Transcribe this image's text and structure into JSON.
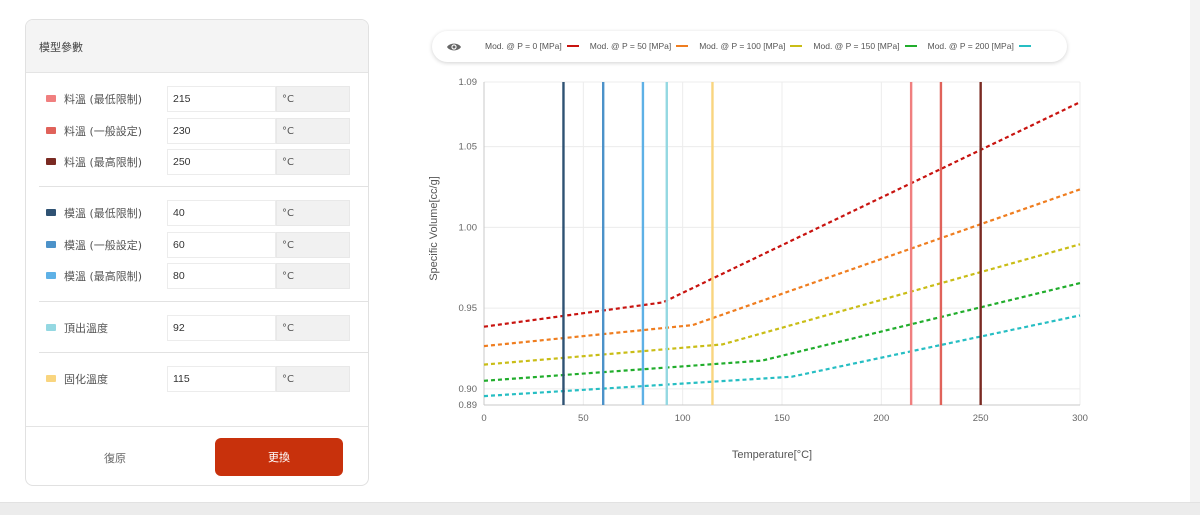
{
  "panel": {
    "title": "模型參數",
    "rows": [
      {
        "label": "料溫 (最低限制)",
        "value": "215",
        "unit": "°C",
        "color": "#f07f7f"
      },
      {
        "label": "料溫 (一般設定)",
        "value": "230",
        "unit": "°C",
        "color": "#e0625a"
      },
      {
        "label": "料溫 (最高限制)",
        "value": "250",
        "unit": "°C",
        "color": "#7a2a22"
      },
      {
        "label": "模溫 (最低限制)",
        "value": "40",
        "unit": "°C",
        "color": "#2f5273"
      },
      {
        "label": "模溫 (一般設定)",
        "value": "60",
        "unit": "°C",
        "color": "#4c92c9"
      },
      {
        "label": "模溫 (最高限制)",
        "value": "80",
        "unit": "°C",
        "color": "#5eb1e6"
      },
      {
        "label": "頂出溫度",
        "value": "92",
        "unit": "°C",
        "color": "#94d8e2"
      },
      {
        "label": "固化溫度",
        "value": "115",
        "unit": "°C",
        "color": "#f9d57f"
      }
    ],
    "reset_label": "復原",
    "apply_label": "更換"
  },
  "chart_data": {
    "type": "line",
    "xlabel": "Temperature[°C]",
    "ylabel": "Specific Volume[cc/g]",
    "xlim": [
      0,
      300
    ],
    "ylim": [
      0.89,
      1.09
    ],
    "x_ticks": [
      0,
      50,
      100,
      150,
      200,
      250,
      300
    ],
    "y_ticks": [
      0.89,
      0.9,
      0.95,
      1.0,
      1.05,
      1.09
    ],
    "y_tick_labels": [
      "0.89",
      "0.90",
      "0.95",
      "1.00",
      "1.05",
      "1.09"
    ],
    "grid": true,
    "legend_position": "top",
    "series": [
      {
        "name": "Mod. @ P = 0 [MPa]",
        "color": "#c8130f",
        "points": [
          [
            0,
            0.9385
          ],
          [
            90,
            0.9535
          ],
          [
            300,
            1.0775
          ]
        ]
      },
      {
        "name": "Mod. @ P = 50 [MPa]",
        "color": "#ef7d1f",
        "points": [
          [
            0,
            0.9265
          ],
          [
            105,
            0.9395
          ],
          [
            300,
            1.0235
          ]
        ]
      },
      {
        "name": "Mod. @ P = 100 [MPa]",
        "color": "#c9bd16",
        "points": [
          [
            0,
            0.915
          ],
          [
            120,
            0.9275
          ],
          [
            300,
            0.9895
          ]
        ]
      },
      {
        "name": "Mod. @ P = 150 [MPa]",
        "color": "#21ad2c",
        "points": [
          [
            0,
            0.905
          ],
          [
            140,
            0.9175
          ],
          [
            300,
            0.9655
          ]
        ]
      },
      {
        "name": "Mod. @ P = 200 [MPa]",
        "color": "#26bec3",
        "points": [
          [
            0,
            0.8955
          ],
          [
            155,
            0.9075
          ],
          [
            300,
            0.9455
          ]
        ]
      }
    ],
    "vertical_lines": [
      {
        "x": 40,
        "color": "#2f5273"
      },
      {
        "x": 60,
        "color": "#4c92c9"
      },
      {
        "x": 80,
        "color": "#5eb1e6"
      },
      {
        "x": 92,
        "color": "#94d8e2"
      },
      {
        "x": 115,
        "color": "#f9d57f"
      },
      {
        "x": 215,
        "color": "#f07f7f"
      },
      {
        "x": 230,
        "color": "#e0625a"
      },
      {
        "x": 250,
        "color": "#7a2a22"
      }
    ]
  }
}
